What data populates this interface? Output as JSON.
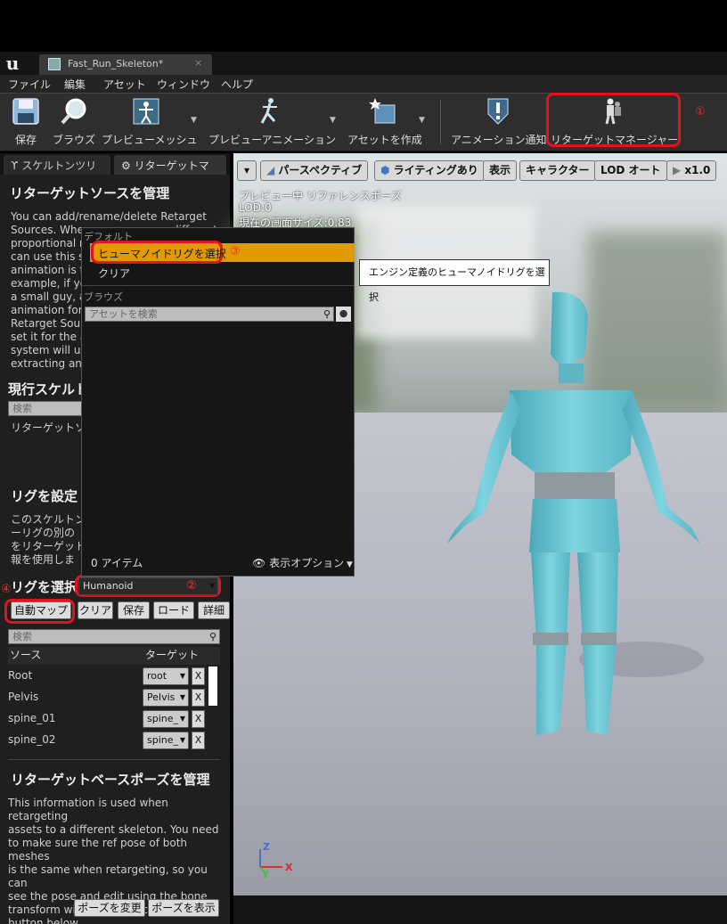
{
  "tab": {
    "title": "Fast_Run_Skeleton*",
    "close": "×"
  },
  "menu": [
    "ファイル",
    "編集",
    "アセット",
    "ウィンドウ",
    "ヘルプ"
  ],
  "toolbar": {
    "save": "保存",
    "browse": "ブラウズ",
    "preview_mesh": "プレビューメッシュ",
    "preview_animation": "プレビューアニメーション",
    "create_asset": "アセットを作成",
    "anim_notify": "アニメーション通知",
    "retarget_manager": "リターゲットマネージャー",
    "marker1": "①"
  },
  "left_tabs": [
    "スケルトンツリ",
    "リターゲットマ"
  ],
  "retarget_sources": {
    "title": "リターゲットソースを管理",
    "lines": [
      "You can add/rename/delete Retarget",
      "Sources. Whe",
      "proportional m",
      "can use this s",
      "animation is fr",
      "example, if yo",
      "a small guy, a",
      "animation for",
      "Retarget Sour",
      "set it for the a",
      "system will us",
      "extracting ani"
    ],
    "frag_1": "different",
    "frag_2": "ource"
  },
  "current_skeleton": {
    "title": "現行スケルトン",
    "search_placeholder": "検索",
    "row": "リターゲットソー"
  },
  "rig_setup": {
    "title": "リグを設定",
    "lines": [
      "このスケルトン",
      "ーリグの別の",
      "をリターゲット",
      "報を使用しま"
    ],
    "select_label": "リグを選択",
    "rig_value": "Humanoid",
    "marker2": "②",
    "marker4": "④",
    "buttons": [
      "自動マップ",
      "クリア",
      "保存",
      "ロード",
      "詳細"
    ],
    "search_placeholder": "検索",
    "col_source": "ソース",
    "col_target": "ターゲット",
    "rows": [
      {
        "source": "Root",
        "target": "root"
      },
      {
        "source": "Pelvis",
        "target": "Pelvis"
      },
      {
        "source": "spine_01",
        "target": "spine_"
      },
      {
        "source": "spine_02",
        "target": "spine_"
      }
    ],
    "x": "X"
  },
  "base_pose": {
    "title": "リターゲットベースポーズを管理",
    "lines": [
      "This information is used when retargeting",
      "assets to a different skeleton. You need",
      "to make sure the ref pose of both meshes",
      "is the same when retargeting, so you can",
      "see the pose and edit using the bone",
      "transform widget, and click the Save",
      "button below."
    ],
    "btn_change": "ポーズを変更",
    "btn_view": "ポーズを表示"
  },
  "viewport": {
    "buttons": [
      "パースペクティブ",
      "ライティングあり",
      "表示",
      "キャラクター",
      "LOD オート",
      "x1.0"
    ],
    "info": [
      "プレビュー中 リファレンスポーズ",
      "LOD:0",
      "現在の画面サイズ:0.83"
    ],
    "axis": {
      "z": "Z",
      "x": "X",
      "y": "Y"
    }
  },
  "dropdown": {
    "header_default": "デフォルト",
    "item_select": "ヒューマノイドリグを選択",
    "marker3": "③",
    "item_clear": "クリア",
    "header_browse": "ブラウズ",
    "search_placeholder": "アセットを検索",
    "count": "0 アイテム",
    "view_options": "表示オプション"
  },
  "tooltip": "エンジン定義のヒューマノイドリグを選択",
  "colors": {
    "highlight": "#e19a00",
    "red_annotation": "#e0141e",
    "mannequin": "#6ec6d4"
  }
}
